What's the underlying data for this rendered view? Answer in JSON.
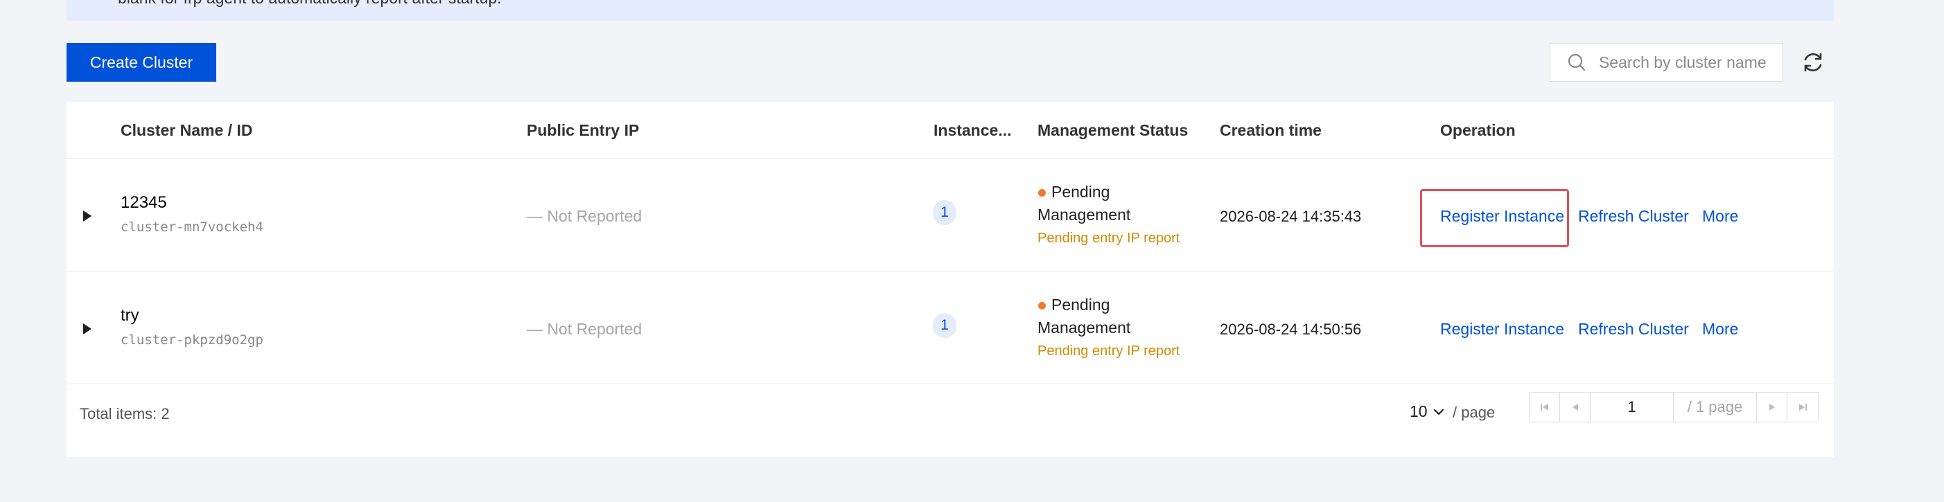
{
  "notice": {
    "text": "blank for frp agent to automatically report after startup."
  },
  "toolbar": {
    "create_label": "Create Cluster",
    "search_placeholder": "Search by cluster name"
  },
  "table": {
    "columns": [
      "Cluster Name / ID",
      "Public Entry IP",
      "Instance...",
      "Management Status",
      "Creation time",
      "Operation"
    ],
    "rows": [
      {
        "name": "12345",
        "id": "cluster-mn7vockeh4",
        "public_ip": "— Not Reported",
        "instances": "1",
        "status_line1": "Pending",
        "status_line2": "Management",
        "status_note": "Pending entry IP report",
        "created": "2026-08-24 14:35:43",
        "ops": [
          "Register Instance",
          "Refresh Cluster",
          "More"
        ]
      },
      {
        "name": "try",
        "id": "cluster-pkpzd9o2gp",
        "public_ip": "— Not Reported",
        "instances": "1",
        "status_line1": "Pending",
        "status_line2": "Management",
        "status_note": "Pending entry IP report",
        "created": "2026-08-24 14:50:56",
        "ops": [
          "Register Instance",
          "Refresh Cluster",
          "More"
        ]
      }
    ]
  },
  "footer": {
    "total": "Total items: 2",
    "page_size": "10",
    "per_page": "/ page",
    "current_page": "1",
    "total_pages": "/ 1 page"
  },
  "colors": {
    "primary": "#0052d9",
    "warning": "#ed7b2f",
    "highlight": "#e34d59"
  }
}
